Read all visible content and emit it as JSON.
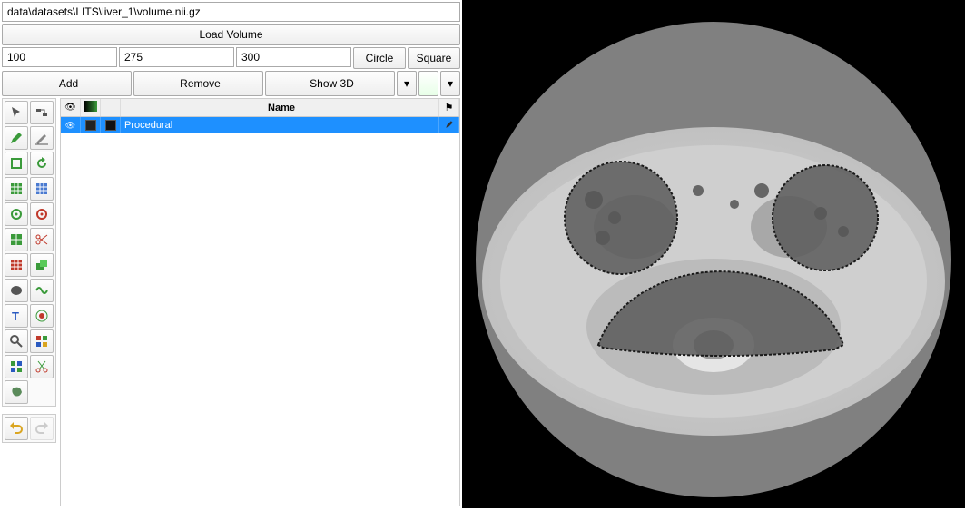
{
  "file_path": "data\\datasets\\LITS\\liver_1\\volume.nii.gz",
  "buttons": {
    "load_volume": "Load Volume",
    "circle": "Circle",
    "square": "Square",
    "add": "Add",
    "remove": "Remove",
    "show3d": "Show 3D"
  },
  "params": {
    "p1": "100",
    "p2": "275",
    "p3": "300"
  },
  "layers": {
    "header_name": "Name",
    "rows": [
      {
        "name": "Procedural"
      }
    ]
  },
  "tool_icons": [
    "cursor-icon",
    "link-icon",
    "pencil-icon",
    "pencil-line-icon",
    "shape-icon",
    "refresh-icon",
    "grid1-icon",
    "grid2-icon",
    "target-icon",
    "target-red-icon",
    "grid3-icon",
    "scissors-icon",
    "grid4-icon",
    "layers-icon",
    "brain-icon",
    "wave-icon",
    "text-icon",
    "record-icon",
    "zoom-icon",
    "palette-icon",
    "tiles-icon",
    "cut-icon",
    "organ-icon"
  ],
  "undo_icons": [
    "undo-icon",
    "redo-icon"
  ]
}
